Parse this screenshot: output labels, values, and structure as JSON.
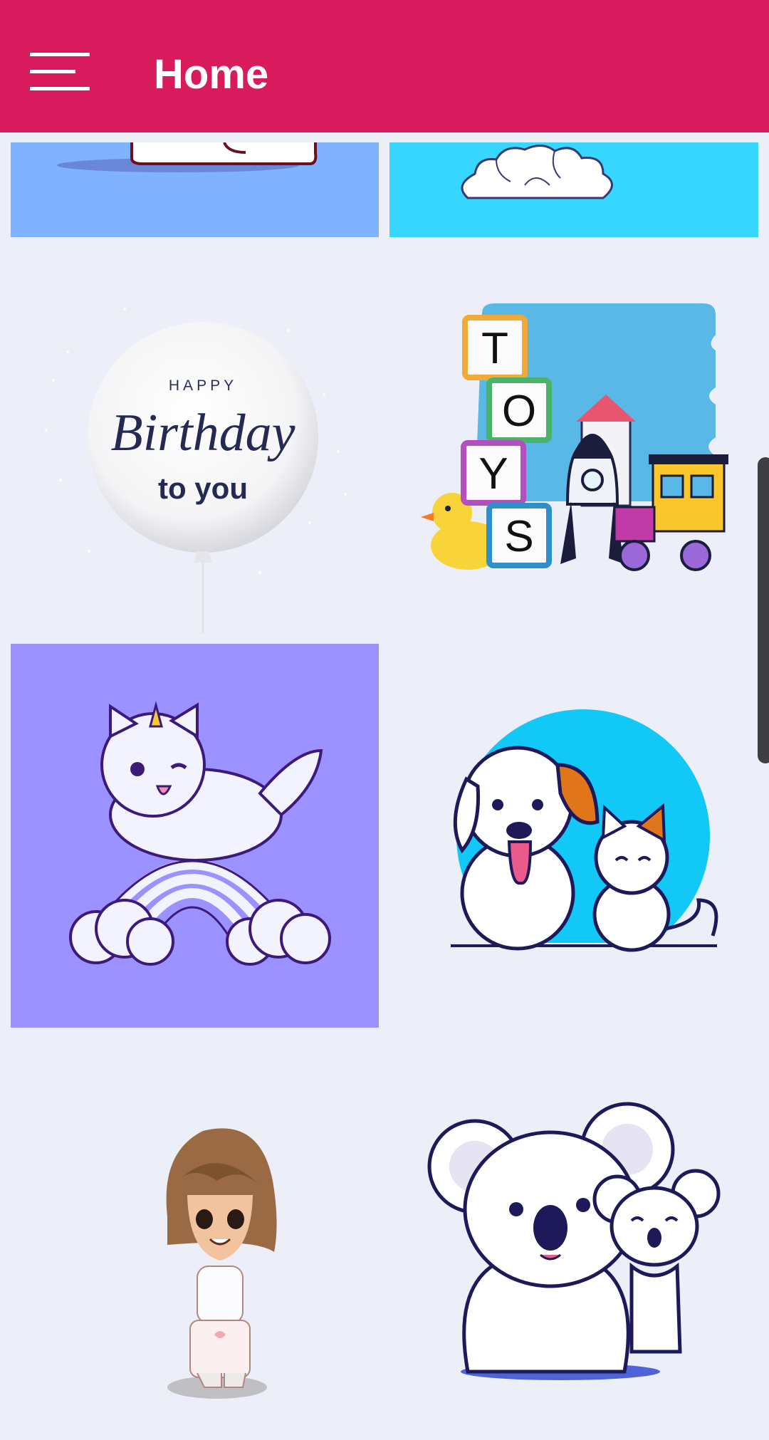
{
  "app_bar": {
    "title": "Home",
    "menu_icon": "hamburger-menu-icon",
    "background_color": "#d81b5c"
  },
  "grid": {
    "tiles": [
      {
        "name": "bunny-card",
        "background": "#7fb2ff"
      },
      {
        "name": "cloud-card",
        "background": "#36d6ff"
      },
      {
        "name": "birthday-balloon-card",
        "background": "#eceef8",
        "text": {
          "line1": "HAPPY",
          "line2": "Birthday",
          "line3": "to you"
        }
      },
      {
        "name": "toys-card",
        "background": "#eceef8",
        "blocks": [
          "T",
          "O",
          "Y",
          "S"
        ]
      },
      {
        "name": "unicorn-cat-card",
        "background": "#9b92ff"
      },
      {
        "name": "dog-and-cat-card",
        "background": "#eceef8"
      },
      {
        "name": "girl-card",
        "background": "#eceef8"
      },
      {
        "name": "koala-card",
        "background": "#eceef8"
      }
    ]
  }
}
